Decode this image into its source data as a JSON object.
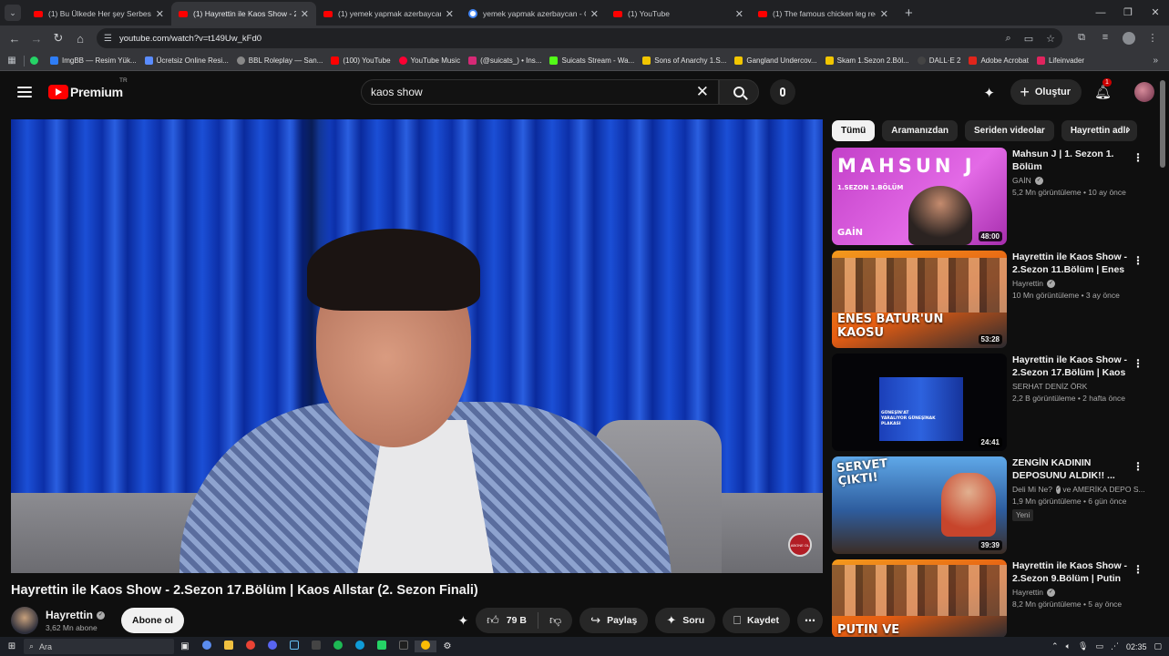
{
  "browser": {
    "tabs": [
      {
        "label": "(1) Bu Ülkede Her şey Serbest «",
        "active": false,
        "favicon": "youtube"
      },
      {
        "label": "(1) Hayrettin ile Kaos Show - 2.S",
        "active": true,
        "favicon": "youtube"
      },
      {
        "label": "(1) yemek yapmak azerbaycan",
        "active": false,
        "favicon": "youtube"
      },
      {
        "label": "yemek yapmak azerbaycan - Go",
        "active": false,
        "favicon": "google"
      },
      {
        "label": "(1) YouTube",
        "active": false,
        "favicon": "youtube"
      },
      {
        "label": "(1) The famous chicken leg reci",
        "active": false,
        "favicon": "youtube"
      }
    ],
    "url": "youtube.com/watch?v=t149Uw_kFd0",
    "bookmarks": [
      {
        "label": "ImgBB — Resim Yük...",
        "color": "#2e7df6"
      },
      {
        "label": "Ücretsiz Online Resi...",
        "color": "#5a8cff"
      },
      {
        "label": "BBL Roleplay — San...",
        "color": "#888888"
      },
      {
        "label": "(100) YouTube",
        "color": "#ff0000"
      },
      {
        "label": "YouTube Music",
        "color": "#ff0033"
      },
      {
        "label": "(@suicats_) • Ins...",
        "color": "#d62976"
      },
      {
        "label": "Suicats Stream - Wa...",
        "color": "#53fc18"
      },
      {
        "label": "Sons of Anarchy 1.S...",
        "color": "#f2c600"
      },
      {
        "label": "Gangland Undercov...",
        "color": "#f2c600"
      },
      {
        "label": "Skam 1.Sezon 2.Böl...",
        "color": "#f2c600"
      },
      {
        "label": "DALL·E 2",
        "color": "#444444"
      },
      {
        "label": "Adobe Acrobat",
        "color": "#e1251b"
      },
      {
        "label": "Lifeinvader",
        "color": "#e0245e"
      }
    ]
  },
  "header": {
    "logo_text": "Premium",
    "country_code": "TR",
    "search_value": "kaos show",
    "create_label": "Oluştur",
    "notification_count": "1"
  },
  "video": {
    "title": "Hayrettin ile Kaos Show - 2.Sezon 17.Bölüm | Kaos Allstar (2. Sezon Finali)",
    "channel_name": "Hayrettin",
    "subscribers": "3,62 Mn abone",
    "subscribe_label": "Abone ol",
    "likes": "79 B",
    "share_label": "Paylaş",
    "ask_label": "Soru",
    "save_label": "Kaydet",
    "watermark": "ABONE OL"
  },
  "chips": [
    "Tümü",
    "Aramanızdan",
    "Seriden videolar",
    "Hayrettin adlı"
  ],
  "recommendations": [
    {
      "title": "Mahsun J | 1. Sezon 1. Bölüm",
      "channel": "GAİN",
      "verified": true,
      "stats": "5,2 Mn görüntüleme • 10 ay önce",
      "duration": "48:00",
      "thumb_text": "MAHSUN J",
      "thumb_sub": "1.SEZON 1.BÖLÜM",
      "thumb_brand": "GAİN",
      "badge": ""
    },
    {
      "title": "Hayrettin ile Kaos Show - 2.Sezon 11.Bölüm | Enes ...",
      "channel": "Hayrettin",
      "verified": true,
      "stats": "10 Mn görüntüleme • 3 ay önce",
      "duration": "53:28",
      "thumb_text": "ENES BATUR'UN KAOSU",
      "badge": ""
    },
    {
      "title": "Hayrettin ile Kaos Show - 2.Sezon 17.Bölüm | Kaos ...",
      "channel": "SERHAT DENİZ ÖRK",
      "verified": false,
      "stats": "2,2 B görüntüleme • 2 hafta önce",
      "duration": "24:41",
      "thumb_text": "GÜNEŞİN'AT YARALIYOR GÜNEŞİNAK PLAKASI",
      "badge": ""
    },
    {
      "title": "ZENGİN KADININ DEPOSUNU ALDIK!! ...",
      "channel": "Deli Mi Ne?",
      "channel_extra": "ve AMERİKA DEPO S...",
      "verified": true,
      "stats": "1,9 Mn görüntüleme • 6 gün önce",
      "duration": "39:39",
      "thumb_text": "SERVET ÇIKTI!",
      "badge": "Yeni"
    },
    {
      "title": "Hayrettin ile Kaos Show - 2.Sezon 9.Bölüm | Putin ve...",
      "channel": "Hayrettin",
      "verified": true,
      "stats": "8,2 Mn görüntüleme • 5 ay önce",
      "duration": "",
      "thumb_text": "PUTIN VE",
      "badge": ""
    }
  ],
  "taskbar": {
    "search_placeholder": "Ara",
    "time": "02:35"
  }
}
